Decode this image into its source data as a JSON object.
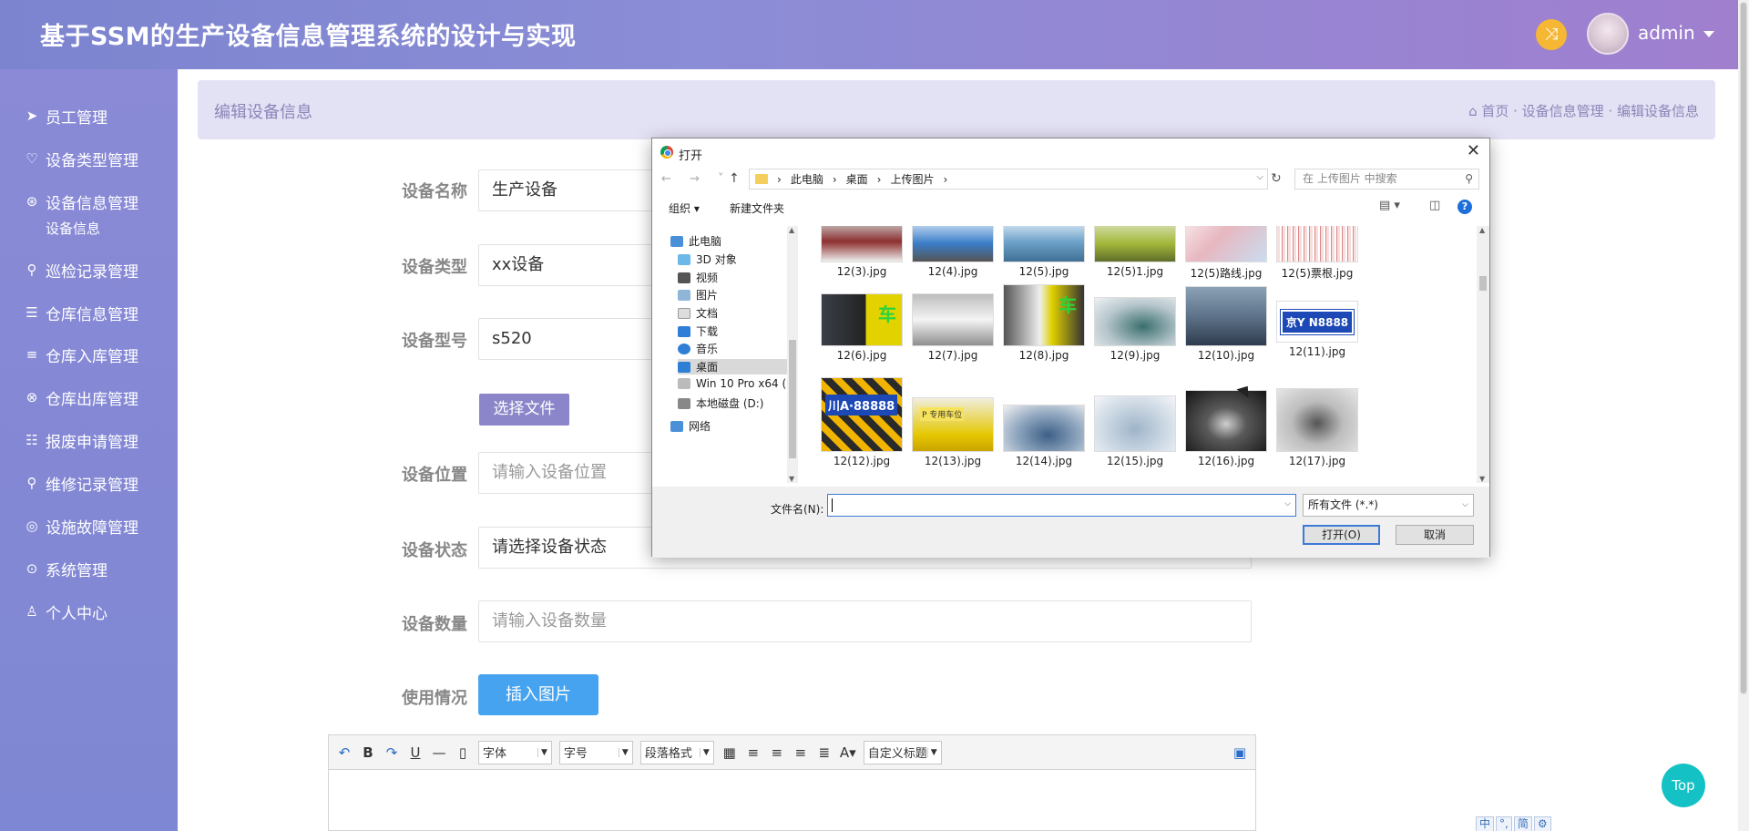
{
  "header": {
    "title": "基于SSM的生产设备信息管理系统的设计与实现",
    "username": "admin",
    "icons": [
      "shuffle-icon",
      "avatar",
      "caret-down-icon"
    ]
  },
  "sidebar": {
    "items": [
      {
        "label": "员工管理",
        "icon": "send-icon",
        "glyph": "➤"
      },
      {
        "label": "设备类型管理",
        "icon": "heart-icon",
        "glyph": "♡"
      },
      {
        "label": "设备信息管理",
        "icon": "aperture-icon",
        "glyph": "⊛"
      },
      {
        "label": "巡检记录管理",
        "icon": "key-icon",
        "glyph": "⚲"
      },
      {
        "label": "仓库信息管理",
        "icon": "list-indent-icon",
        "glyph": "☰"
      },
      {
        "label": "仓库入库管理",
        "icon": "bars-icon",
        "glyph": "≡"
      },
      {
        "label": "仓库出库管理",
        "icon": "close-circle-icon",
        "glyph": "⊗"
      },
      {
        "label": "报废申请管理",
        "icon": "list-check-icon",
        "glyph": "☷"
      },
      {
        "label": "维修记录管理",
        "icon": "search-icon",
        "glyph": "⚲"
      },
      {
        "label": "设施故障管理",
        "icon": "user-circle-icon",
        "glyph": "◎"
      },
      {
        "label": "系统管理",
        "icon": "arrow-up-circle-icon",
        "glyph": "⊙"
      },
      {
        "label": "个人中心",
        "icon": "user-icon",
        "glyph": "♙"
      }
    ],
    "sub_item": "设备信息"
  },
  "breadcrumb": {
    "page_title": "编辑设备信息",
    "home": "首页",
    "path": "首页 · 设备信息管理 · 编辑设备信息"
  },
  "form": {
    "name_label": "设备名称",
    "name_value": "生产设备",
    "type_label": "设备类型",
    "type_value": "xx设备",
    "model_label": "设备型号",
    "model_value": "s520",
    "file_button": "选择文件",
    "location_label": "设备位置",
    "location_placeholder": "请输入设备位置",
    "status_label": "设备状态",
    "status_value": "请选择设备状态",
    "qty_label": "设备数量",
    "qty_placeholder": "请输入设备数量",
    "usage_label": "使用情况",
    "insert_button": "插入图片"
  },
  "editor": {
    "font": "字体",
    "size": "字号",
    "paragraph": "段落格式",
    "custom_title": "自定义标题"
  },
  "top_button": "Top",
  "ime": [
    "中",
    "°,",
    "简",
    "⚙"
  ],
  "dialog": {
    "title": "打开",
    "close": "✕",
    "address": [
      "此电脑",
      "桌面",
      "上传图片"
    ],
    "search_placeholder": "在 上传图片 中搜索",
    "organize": "组织 ▾",
    "new_folder": "新建文件夹",
    "help": "?",
    "nav": [
      "此电脑",
      "3D 对象",
      "视频",
      "图片",
      "文档",
      "下载",
      "音乐",
      "桌面",
      "Win 10 Pro x64 (",
      "本地磁盘 (D:)",
      "网络"
    ],
    "files": [
      "12(3).jpg",
      "12(4).jpg",
      "12(5).jpg",
      "12(5)1.jpg",
      "12(5)路线.jpg",
      "12(5)票根.jpg",
      "12(6).jpg",
      "12(7).jpg",
      "12(8).jpg",
      "12(9).jpg",
      "12(10).jpg",
      "12(11).jpg",
      "12(12).jpg",
      "12(13).jpg",
      "12(14).jpg",
      "12(15).jpg",
      "12(16).jpg",
      "12(17).jpg"
    ],
    "thumb_text": {
      "car1": "车",
      "car2": "车",
      "plate": "京Y N8888",
      "plate2": "川A·88888",
      "parking": "P 专用车位"
    },
    "filename_label": "文件名(N):",
    "filename_value": "",
    "filetype": "所有文件 (*.*)",
    "open_button": "打开(O)",
    "cancel_button": "取消"
  }
}
